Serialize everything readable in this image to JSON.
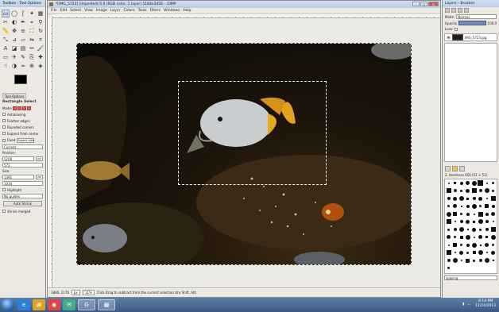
{
  "toolbox": {
    "title": "Toolbox - Tool Options",
    "tools": [
      "rect-select-icon",
      "ellipse-select-icon",
      "free-select-icon",
      "fuzzy-select-icon",
      "color-select-icon",
      "scissors-icon",
      "foreground-select-icon",
      "paths-icon",
      "color-picker-icon",
      "zoom-icon",
      "measure-icon",
      "move-icon",
      "align-icon",
      "crop-icon",
      "rotate-icon",
      "scale-icon",
      "shear-icon",
      "perspective-icon",
      "flip-icon",
      "cage-icon",
      "text-icon",
      "bucket-fill-icon",
      "blend-icon",
      "pencil-icon",
      "paintbrush-icon",
      "eraser-icon",
      "airbrush-icon",
      "ink-icon",
      "clone-icon",
      "heal-icon",
      "smudge-icon",
      "dodge-icon",
      "blur-icon",
      "perspective-clone-icon",
      "color-icon"
    ],
    "tool_glyphs": [
      "▭",
      "◯",
      "ʃ",
      "✦",
      "▦",
      "✂",
      "◐",
      "✒",
      "⌖",
      "⚲",
      "📏",
      "✥",
      "≡",
      "⛶",
      "↻",
      "⤡",
      "⊿",
      "▱",
      "⇋",
      "⌗",
      "A",
      "◪",
      "▤",
      "✏",
      "🖌",
      "▭",
      "✈",
      "✎",
      "⎘",
      "✚",
      "☝",
      "◑",
      "≈",
      "⊕",
      "◈"
    ],
    "options_tabs": [
      "Tool Options"
    ],
    "options_title": "Rectangle Select",
    "mode_label": "Mode:",
    "antialiasing": "Antialiasing",
    "feather_edges": "Feather edges",
    "rounded_corners": "Rounded corners",
    "expand_from_center": "Expand from center",
    "fixed_label": "Fixed",
    "fixed_value": "Aspect ratio",
    "current_value": "Current",
    "position_label": "Position:",
    "position_x": "1206",
    "position_y": "572",
    "position_unit": "px",
    "size_label": "Size:",
    "size_w": "1391",
    "size_h": "1034",
    "size_unit": "px",
    "highlight": "Highlight",
    "guides_value": "No guides",
    "auto_shrink": "Auto Shrink",
    "shrink_merged": "Shrink merged"
  },
  "main": {
    "title": "*[IMG_5723] (imported)-5.0 (RGB color, 1 layer) 5184x3456 – GIMP",
    "menus": [
      "File",
      "Edit",
      "Select",
      "View",
      "Image",
      "Layer",
      "Colors",
      "Tools",
      "Filters",
      "Windows",
      "Help"
    ],
    "win_buttons": [
      "–",
      "□",
      "✕"
    ],
    "status_coords": "3880, 2176",
    "status_unit": "px",
    "status_zoom": "11%",
    "status_message": "Click-Drag to subtract from the current selection (try Shift, Alt)"
  },
  "dock": {
    "title": "Layers - Brushes",
    "mode_label": "Mode:",
    "mode_value": "Normal",
    "opacity_label": "Opacity",
    "opacity_value": "100.0",
    "lock_label": "Lock:",
    "layer_name": "IMG_5723.jpg",
    "brush_title": "2. Hardness 050 (51 × 51)",
    "brush_sizes": [
      2,
      3,
      4,
      5,
      6,
      7,
      2,
      3,
      5,
      6,
      4,
      3,
      5,
      6,
      4,
      6,
      3,
      2,
      4,
      5,
      6,
      3,
      4,
      5,
      2,
      6,
      4,
      3,
      5,
      2,
      4,
      6,
      3,
      5,
      4,
      2,
      6,
      5,
      3,
      4,
      2,
      6,
      4,
      5,
      3,
      6,
      2,
      4,
      5,
      3,
      6,
      4,
      2,
      5,
      3,
      4,
      6,
      2,
      5,
      3,
      4,
      6,
      2,
      5,
      3,
      4,
      6,
      2,
      5,
      3,
      6,
      4,
      2,
      5,
      3,
      4,
      6,
      2,
      5,
      3,
      4,
      6,
      2,
      5,
      3,
      4,
      6,
      2,
      5,
      3,
      4,
      6,
      2,
      5,
      3,
      4,
      6,
      2,
      5,
      3
    ],
    "tag_value": "spacing"
  },
  "taskbar": {
    "icons": [
      "ie-icon",
      "explorer-icon",
      "chrome-icon",
      "mail-icon",
      "gimp-icon",
      "gimp-window-icon"
    ],
    "icon_glyphs": [
      "e",
      "📁",
      "◉",
      "✉",
      "G",
      "▦"
    ],
    "icon_colors": [
      "#2f7fd8",
      "#e0a030",
      "#d44",
      "#4a8",
      "#aa8",
      "#777"
    ],
    "time": "8:14 PM",
    "date": "11/24/2013"
  },
  "colors": {
    "accent": "#b8cde6",
    "taskbar": "#3a5a84"
  }
}
